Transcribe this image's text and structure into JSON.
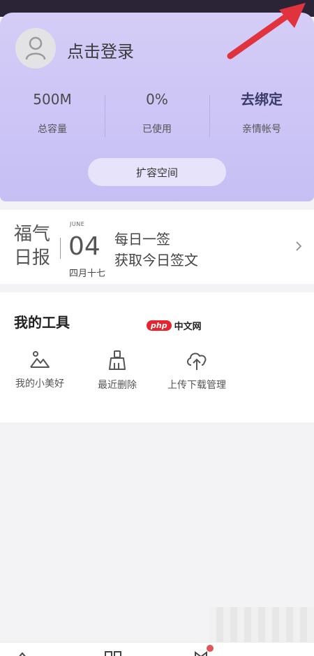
{
  "profile": {
    "login_label": "点击登录",
    "stats": [
      {
        "value": "500M",
        "label": "总容量"
      },
      {
        "value": "0%",
        "label": "已使用"
      },
      {
        "value": "去绑定",
        "label": "亲情帐号"
      }
    ],
    "expand_label": "扩容空间"
  },
  "daily": {
    "brand_line1": "福气",
    "brand_line2": "日报",
    "month": "JUNE",
    "day": "04",
    "lunar_date": "四月十七",
    "sign_line1": "每日一签",
    "sign_line2": "获取今日签文"
  },
  "tools": {
    "title": "我的工具",
    "items": [
      {
        "label": "我的小美好",
        "icon": "mountain-icon"
      },
      {
        "label": "最近删除",
        "icon": "brush-icon"
      },
      {
        "label": "上传下载管理",
        "icon": "cloud-upload-icon"
      }
    ]
  },
  "watermark": {
    "logo": "php",
    "text": "中文网"
  },
  "colors": {
    "card_gradient_top": "#d4cdf7",
    "card_gradient_bottom": "#c6bff4",
    "arrow": "#e0333d",
    "badge": "#e05555"
  }
}
